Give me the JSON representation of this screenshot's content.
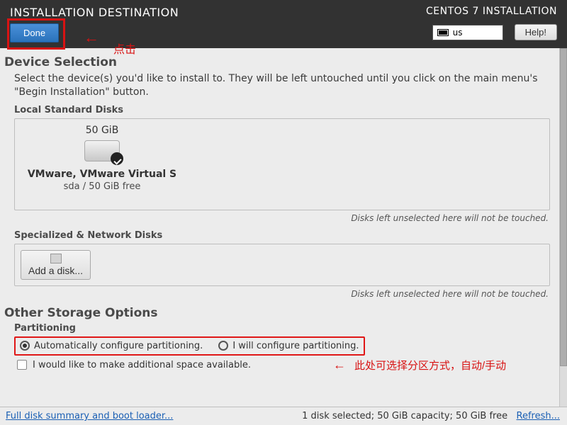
{
  "header": {
    "title": "INSTALLATION DESTINATION",
    "done": "Done",
    "product": "CENTOS 7 INSTALLATION",
    "keyboard": "us",
    "help": "Help!"
  },
  "device_selection": {
    "title": "Device Selection",
    "desc": "Select the device(s) you'd like to install to.  They will be left untouched until you click on the main menu's \"Begin Installation\" button."
  },
  "local_disks": {
    "heading": "Local Standard Disks",
    "hint": "Disks left unselected here will not be touched.",
    "items": [
      {
        "size": "50 GiB",
        "name": "VMware, VMware Virtual S",
        "sub": "sda     /     50 GiB free",
        "selected": true
      }
    ]
  },
  "network_disks": {
    "heading": "Specialized & Network Disks",
    "add_label": "Add a disk...",
    "hint": "Disks left unselected here will not be touched."
  },
  "other_storage": {
    "title": "Other Storage Options",
    "partitioning_label": "Partitioning",
    "auto": "Automatically configure partitioning.",
    "manual": "I will configure partitioning.",
    "additional_space": "I would like to make additional space available."
  },
  "footer": {
    "link": "Full disk summary and boot loader...",
    "status": "1 disk selected; 50 GiB capacity; 50 GiB free",
    "refresh": "Refresh..."
  },
  "annotations": {
    "click": "点击",
    "partition_hint": "此处可选择分区方式，自动/手动"
  }
}
